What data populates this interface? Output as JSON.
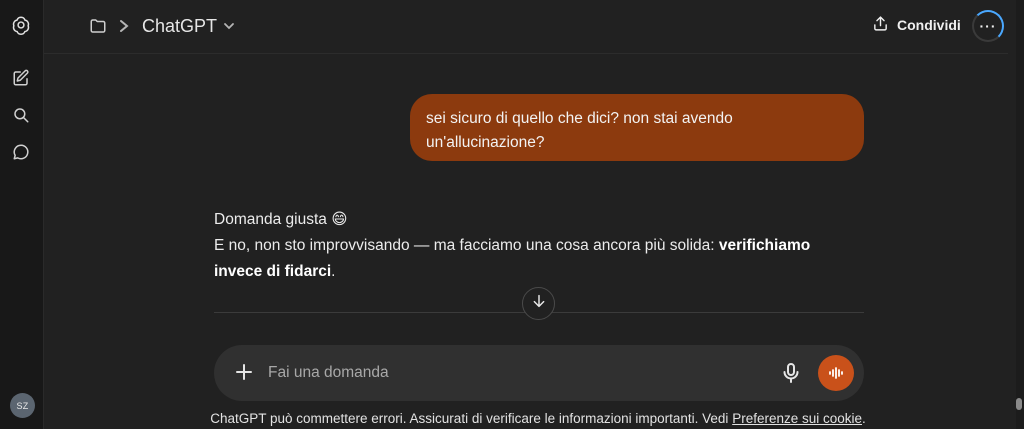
{
  "sidebar": {
    "avatar_initials": "SZ"
  },
  "header": {
    "model_name": "ChatGPT",
    "share_label": "Condividi",
    "more_label": "···"
  },
  "conversation": {
    "user_message": "sei sicuro di quello che dici? non stai avendo un'allucinazione?",
    "assistant": {
      "line1": "Domanda giusta",
      "line1_emoji": "😄",
      "line2_prefix": "E no, non sto improvvisando — ma facciamo una cosa ancora più solida: ",
      "line2_bold": "verifichiamo invece di fidarci",
      "line2_suffix": "."
    }
  },
  "composer": {
    "placeholder": "Fai una domanda"
  },
  "footer": {
    "text": "ChatGPT può commettere errori. Assicurati di verificare le informazioni importanti. Vedi ",
    "link": "Preferenze sui cookie",
    "end": "."
  },
  "colors": {
    "background": "#212121",
    "sidebar": "#181818",
    "user_bubble": "#8c3a0e",
    "voice_button": "#c9511a"
  }
}
